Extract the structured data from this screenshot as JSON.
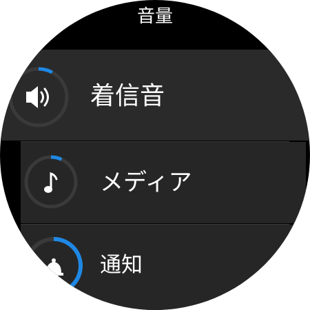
{
  "screen": {
    "title": "音量"
  },
  "items": [
    {
      "label": "着信音",
      "icon": "speaker-icon",
      "level": 0.08,
      "accent": "#1e88e5"
    },
    {
      "label": "メディア",
      "icon": "music-note-icon",
      "level": 0.07,
      "accent": "#1e88e5"
    },
    {
      "label": "通知",
      "icon": "bell-icon",
      "level": 0.42,
      "accent": "#1e88e5"
    }
  ],
  "colors": {
    "background": "#000000",
    "item_background": "#262626",
    "ring_track": "#3a3a3a",
    "text": "#ffffff"
  }
}
